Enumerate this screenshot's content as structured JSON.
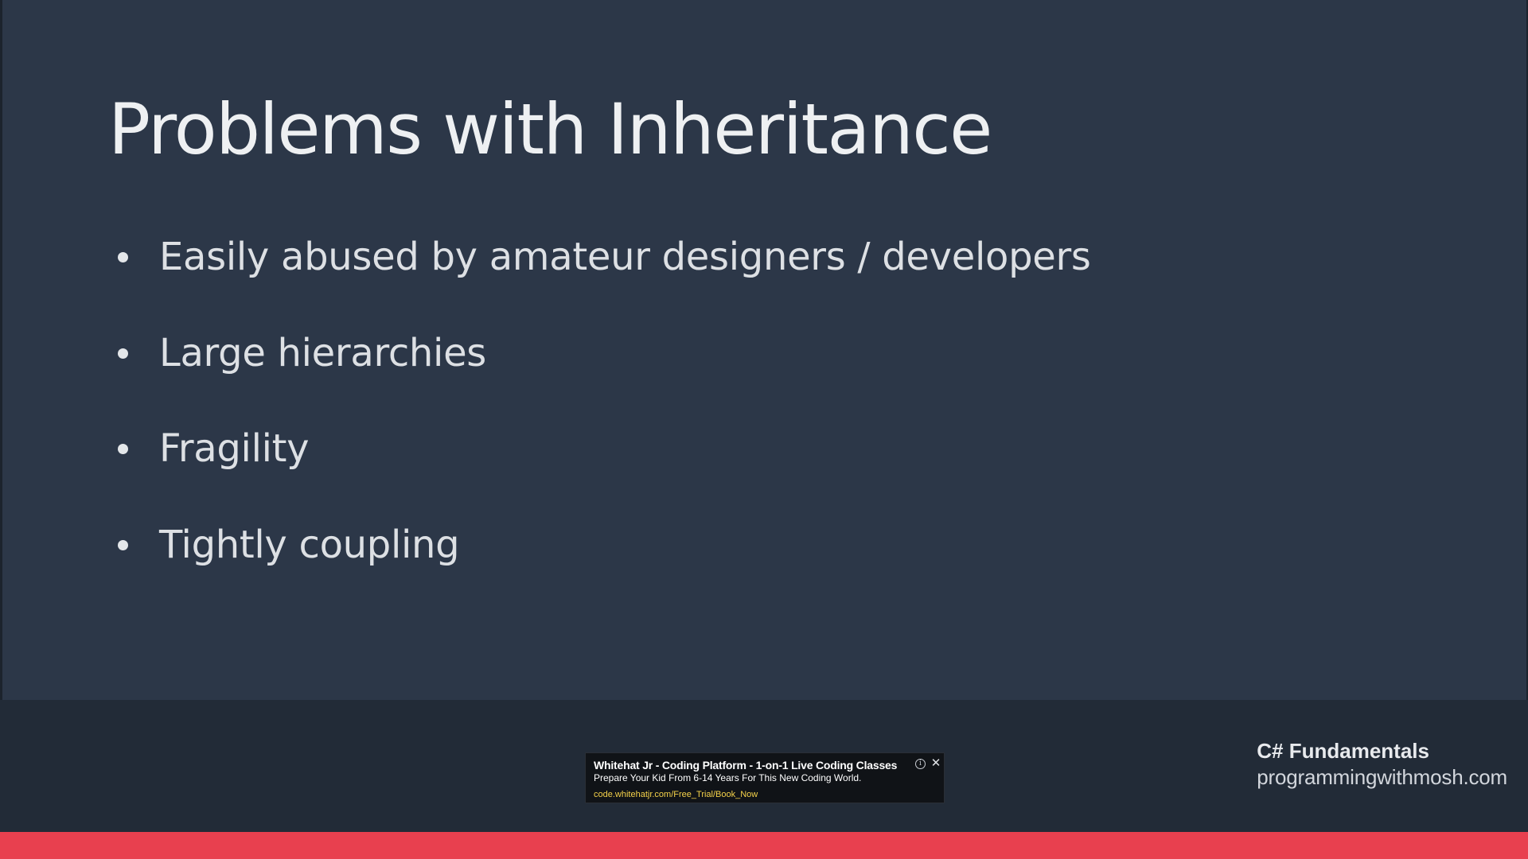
{
  "slide": {
    "title": "Problems with Inheritance",
    "bullets": [
      "Easily abused by amateur designers / developers",
      "Large hierarchies",
      "Fragility",
      "Tightly coupling"
    ]
  },
  "branding": {
    "course": "C# Fundamentals",
    "site": "programmingwithmosh.com"
  },
  "ad": {
    "headline": "Whitehat Jr - Coding Platform - 1-on-1 Live Coding Classes",
    "description": "Prepare Your Kid From 6-14 Years For This New Coding World.",
    "url": "code.whitehatjr.com/Free_Trial/Book_Now",
    "info_icon": "info-icon",
    "close_icon": "close-icon"
  },
  "colors": {
    "slide_background": "#2c3748",
    "footer_band": "#222b37",
    "accent_bar": "#e8404f",
    "ad_url": "#f5d24a"
  }
}
